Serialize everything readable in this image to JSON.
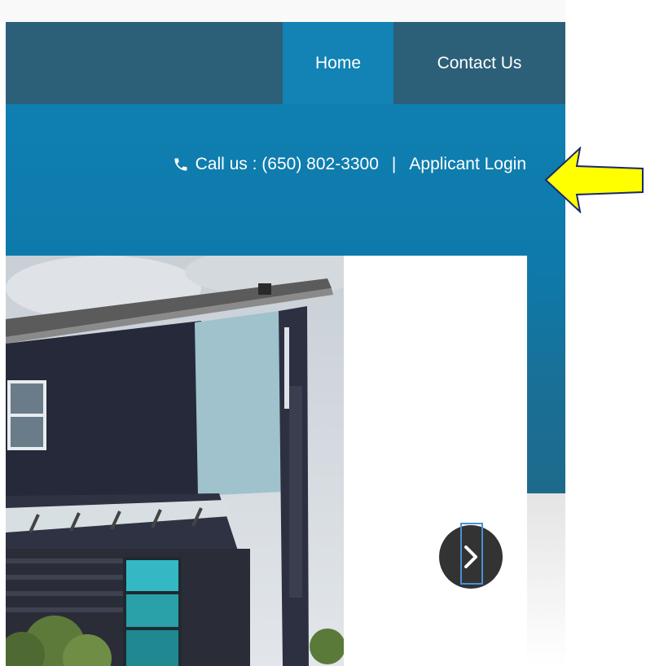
{
  "nav": {
    "tabs": [
      {
        "label": "Home",
        "active": true
      },
      {
        "label": "Contact Us",
        "active": false
      }
    ]
  },
  "infobar": {
    "phone_text": "Call us : (650) 802-3300",
    "separator": "|",
    "login_label": "Applicant Login",
    "icon": "phone-icon"
  },
  "slider": {
    "next_icon": "chevron-right-icon"
  },
  "colors": {
    "nav_bg": "#2c5f78",
    "active_tab": "#1283b4",
    "band": "#0f7fb1",
    "annotation": "#ffff00"
  }
}
